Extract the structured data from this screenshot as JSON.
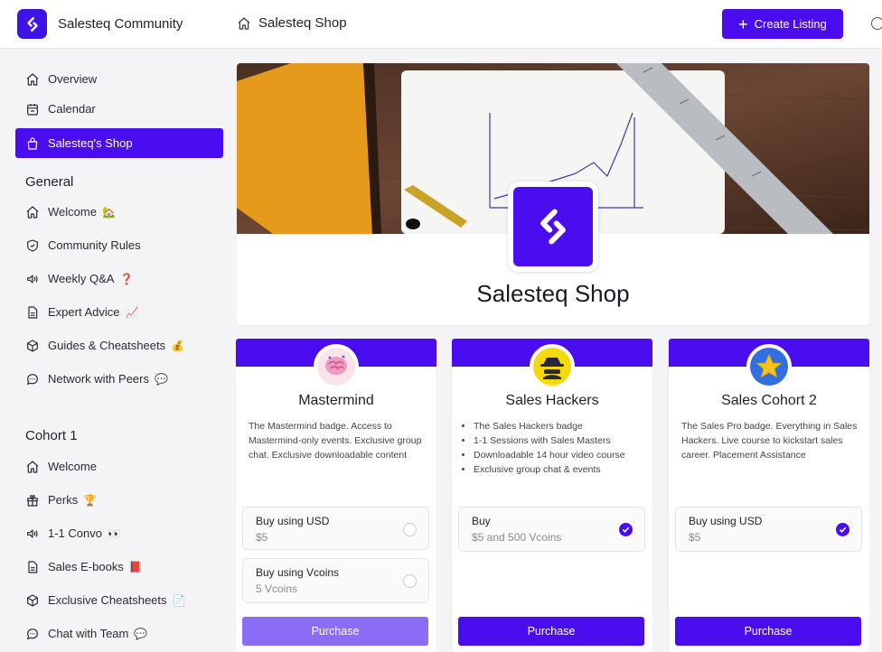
{
  "header": {
    "brand_name": "Salesteq Community",
    "breadcrumb": "Salesteq Shop",
    "create_label": "Create Listing"
  },
  "sidebar": {
    "top_items": [
      {
        "label": "Overview",
        "icon": "home-icon"
      },
      {
        "label": "Calendar",
        "icon": "calendar-icon"
      },
      {
        "label": "Salesteq's Shop",
        "icon": "shopping-bag-icon",
        "active": true
      }
    ],
    "sections": [
      {
        "title": "General",
        "items": [
          {
            "label": "Welcome",
            "icon": "home-icon",
            "emoji": "🏡"
          },
          {
            "label": "Community Rules",
            "icon": "shield-icon",
            "emoji": ""
          },
          {
            "label": "Weekly Q&A",
            "icon": "megaphone-icon",
            "emoji": "❓"
          },
          {
            "label": "Expert Advice",
            "icon": "document-icon",
            "emoji": "📈"
          },
          {
            "label": "Guides & Cheatsheets",
            "icon": "cube-icon",
            "emoji": "💰"
          },
          {
            "label": "Network with Peers",
            "icon": "chat-icon",
            "emoji": "💬"
          }
        ]
      },
      {
        "title": "Cohort 1",
        "items": [
          {
            "label": "Welcome",
            "icon": "home-icon",
            "emoji": ""
          },
          {
            "label": "Perks",
            "icon": "gift-icon",
            "emoji": "🏆"
          },
          {
            "label": "1-1 Convo",
            "icon": "megaphone-icon",
            "emoji": "👀"
          },
          {
            "label": "Sales E-books",
            "icon": "document-icon",
            "emoji": "📕"
          },
          {
            "label": "Exclusive Cheatsheets",
            "icon": "cube-icon",
            "emoji": "📄"
          },
          {
            "label": "Chat with Team",
            "icon": "chat-icon",
            "emoji": "💬"
          }
        ]
      }
    ]
  },
  "hero": {
    "title": "Salesteq Shop"
  },
  "cards": [
    {
      "title": "Mastermind",
      "badge": "brain-icon",
      "desc": "The Mastermind badge. Access to Mastermind-only events. Exclusive group chat. Exclusive downloadable content",
      "options": [
        {
          "label": "Buy using USD",
          "price": "$5",
          "selected": false
        },
        {
          "label": "Buy using Vcoins",
          "price": "5 Vcoins",
          "selected": false
        }
      ],
      "button": "Purchase"
    },
    {
      "title": "Sales Hackers",
      "badge": "spy-icon",
      "bullets": [
        "The Sales Hackers badge",
        "1-1 Sessions with Sales Masters",
        "Downloadable 14 hour video course",
        "Exclusive group chat & events"
      ],
      "options": [
        {
          "label": "Buy",
          "price": "$5 and 500 Vcoins",
          "selected": true
        }
      ],
      "button": "Purchase"
    },
    {
      "title": "Sales Cohort 2",
      "badge": "star-icon",
      "desc": "The Sales Pro badge. Everything in Sales Hackers. Live course to kickstart sales career. Placement Assistance",
      "options": [
        {
          "label": "Buy using USD",
          "price": "$5",
          "selected": true
        }
      ],
      "button": "Purchase"
    }
  ],
  "colors": {
    "accent": "#4a0df0",
    "accent_light": "#8b6cf5"
  }
}
